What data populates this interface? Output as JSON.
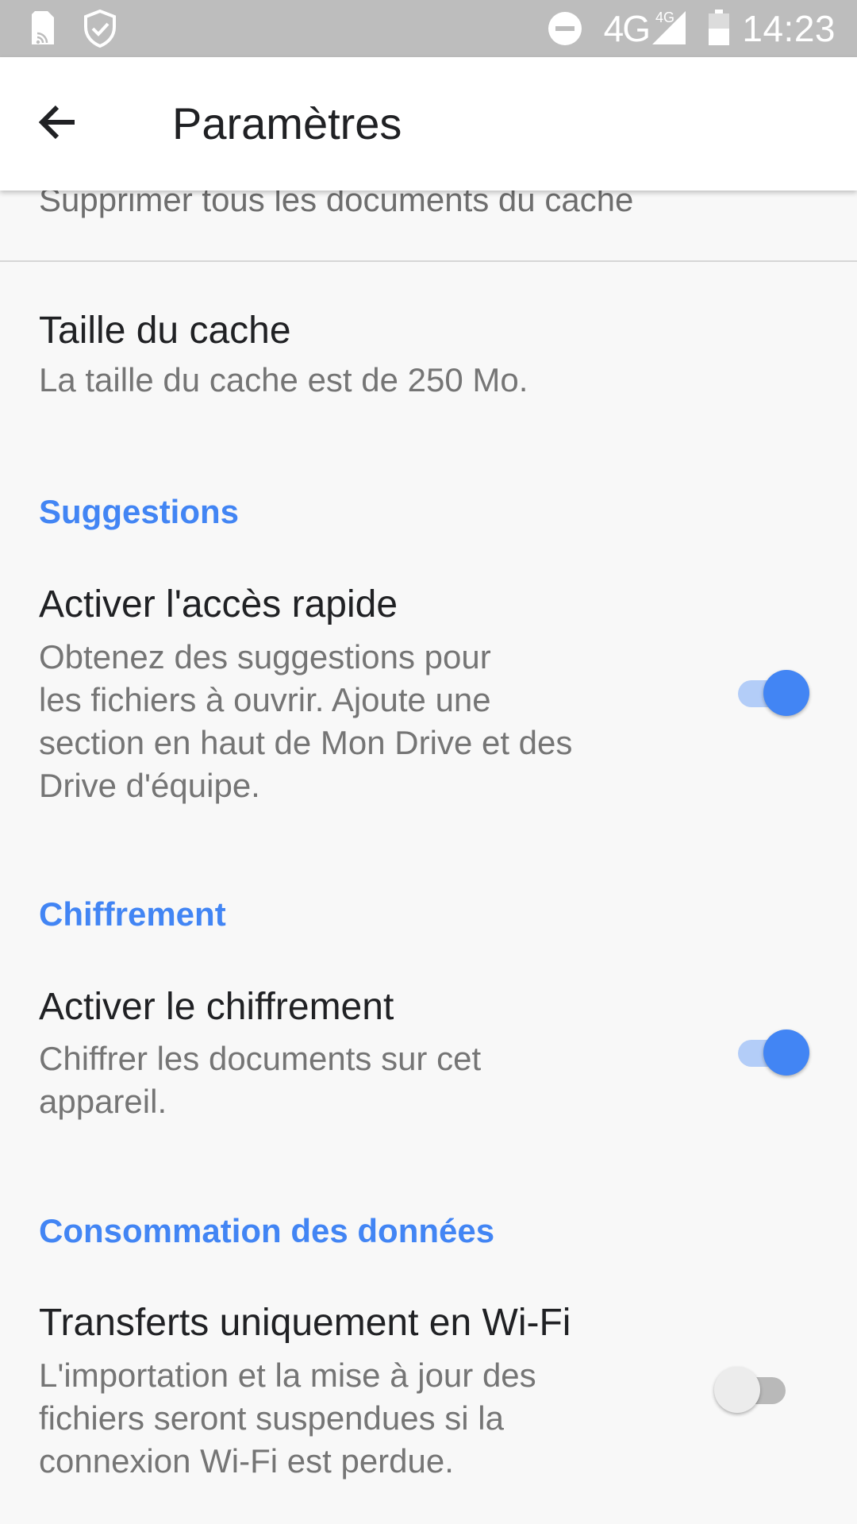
{
  "status_bar": {
    "time": "14:23",
    "network": "4G",
    "network_small": "4G",
    "icons": [
      "sim-storage-icon",
      "shield-check-icon",
      "do-not-disturb-icon",
      "signal-icon",
      "battery-icon"
    ]
  },
  "app_bar": {
    "back_icon": "arrow-back-icon",
    "title": "Paramètres"
  },
  "settings": {
    "cut_item_summary": "Supprimer tous les documents du cache",
    "cache_size": {
      "title": "Taille du cache",
      "summary": "La taille du cache est de 250 Mo."
    },
    "suggestions": {
      "header": "Suggestions",
      "quick_access": {
        "title": "Activer l'accès rapide",
        "summary": "Obtenez des suggestions pour\nles fichiers à ouvrir. Ajoute une\nsection en haut de Mon Drive et des\nDrive d'équipe.",
        "enabled": true
      }
    },
    "encryption": {
      "header": "Chiffrement",
      "enable": {
        "title": "Activer le chiffrement",
        "summary": "Chiffrer les documents sur cet\nappareil.",
        "enabled": true
      }
    },
    "data_usage": {
      "header": "Consommation des données",
      "wifi_only": {
        "title": "Transferts uniquement en Wi-Fi",
        "summary": "L'importation et la mise à jour des\nfichiers seront suspendues si la\nconnexion Wi-Fi est perdue.",
        "enabled": false
      }
    }
  },
  "colors": {
    "accent": "#4285f4",
    "status_bar": "#bdbdbd",
    "background": "#f8f8f8"
  }
}
